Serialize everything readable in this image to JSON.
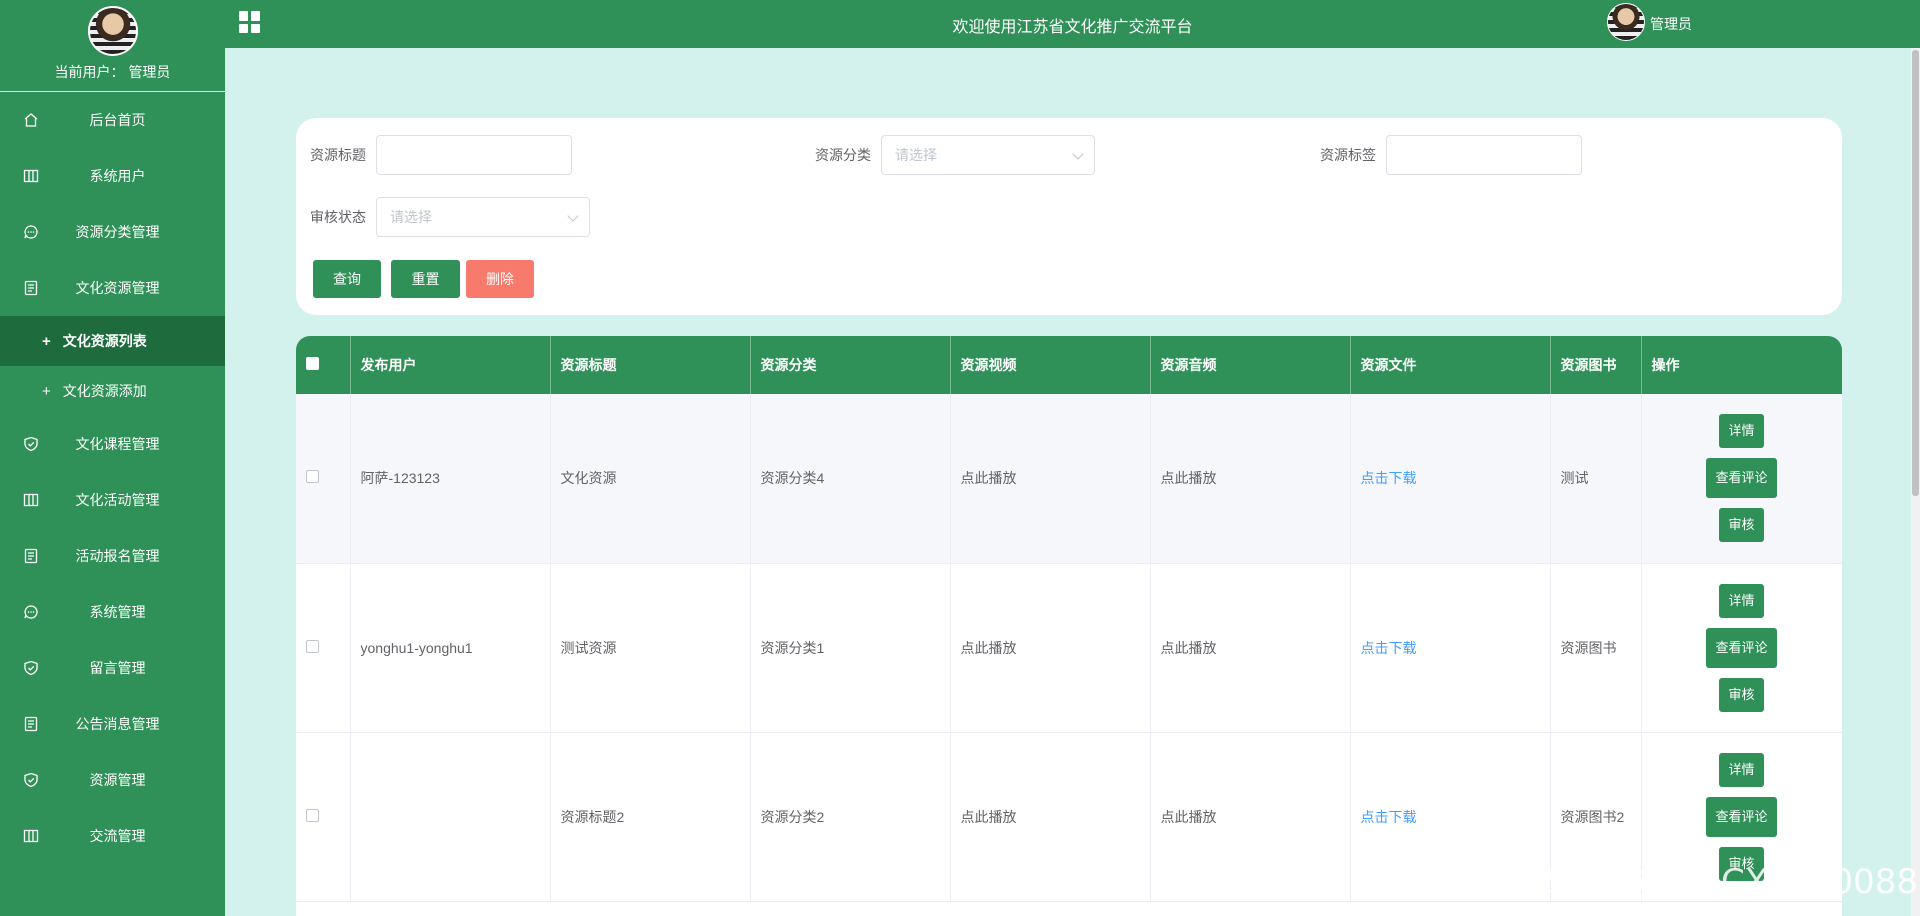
{
  "sidebar": {
    "current_user_label": "当前用户：",
    "current_user_name": "管理员",
    "items": [
      {
        "label": "后台首页",
        "icon": "home-icon"
      },
      {
        "label": "系统用户",
        "icon": "columns-icon"
      },
      {
        "label": "资源分类管理",
        "icon": "chat-icon"
      },
      {
        "label": "文化资源管理",
        "icon": "document-icon"
      },
      {
        "label": "文化课程管理",
        "icon": "shield-check-icon"
      },
      {
        "label": "文化活动管理",
        "icon": "columns-icon"
      },
      {
        "label": "活动报名管理",
        "icon": "document-icon"
      },
      {
        "label": "系统管理",
        "icon": "chat-icon"
      },
      {
        "label": "留言管理",
        "icon": "shield-check-icon"
      },
      {
        "label": "公告消息管理",
        "icon": "document-icon"
      },
      {
        "label": "资源管理",
        "icon": "shield-check-icon"
      },
      {
        "label": "交流管理",
        "icon": "columns-icon"
      }
    ],
    "subitems": [
      {
        "label": "文化资源列表",
        "active": true
      },
      {
        "label": "文化资源添加",
        "active": false
      }
    ]
  },
  "topbar": {
    "title": "欢迎使用江苏省文化推广交流平台",
    "user_name": "管理员"
  },
  "search": {
    "title_label": "资源标题",
    "title_value": "",
    "category_label": "资源分类",
    "category_placeholder": "请选择",
    "tag_label": "资源标签",
    "tag_value": "",
    "status_label": "审核状态",
    "status_placeholder": "请选择",
    "query_button": "查询",
    "reset_button": "重置",
    "delete_button": "删除"
  },
  "table": {
    "columns": [
      "发布用户",
      "资源标题",
      "资源分类",
      "资源视频",
      "资源音频",
      "资源文件",
      "资源图书",
      "操作"
    ],
    "rows": [
      {
        "user": "阿萨-123123",
        "title": "文化资源",
        "category": "资源分类4",
        "video": "点此播放",
        "audio": "点此播放",
        "file": "点击下载",
        "book": "测试"
      },
      {
        "user": "yonghu1-yonghu1",
        "title": "测试资源",
        "category": "资源分类1",
        "video": "点此播放",
        "audio": "点此播放",
        "file": "点击下载",
        "book": "资源图书"
      },
      {
        "user": "",
        "title": "资源标题2",
        "category": "资源分类2",
        "video": "点此播放",
        "audio": "点此播放",
        "file": "点击下载",
        "book": "资源图书2"
      }
    ],
    "actions": {
      "detail": "详情",
      "comments": "查看评论",
      "review": "审核"
    }
  },
  "watermark": "CSDN @vx_CXKF10088",
  "colors": {
    "primary": "#2f9157",
    "active_sub": "#1e6b3d",
    "danger": "#f87a6c",
    "link": "#409eff",
    "page_bg": "#d3f2ee"
  }
}
